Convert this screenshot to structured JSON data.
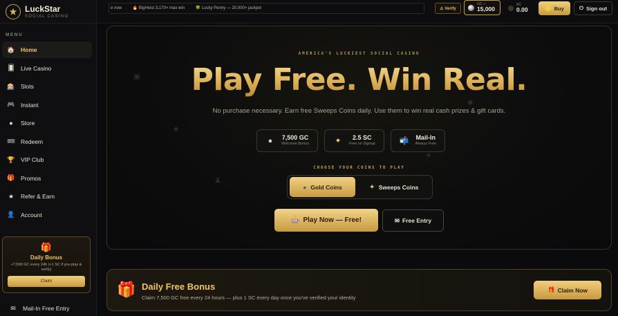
{
  "brand": {
    "name": "LuckStar",
    "tagline": "SOCIAL CASINO",
    "logo_icon": "star-coin-logo"
  },
  "sidebar": {
    "menu_title": "MENU",
    "items": [
      {
        "label": "Home",
        "icon": "🏠",
        "active": true
      },
      {
        "label": "Live Casino",
        "icon": "🂠"
      },
      {
        "label": "Slots",
        "icon": "🎰"
      },
      {
        "label": "Instant",
        "icon": "🎮"
      },
      {
        "label": "Store",
        "icon": "●"
      },
      {
        "label": "Redeem",
        "icon": "🎟"
      },
      {
        "label": "VIP Club",
        "icon": "🏆"
      },
      {
        "label": "Promos",
        "icon": "🎁"
      },
      {
        "label": "Refer & Earn",
        "icon": "★"
      },
      {
        "label": "Account",
        "icon": "👤"
      }
    ],
    "bonus_card": {
      "icon": "🎁",
      "title": "Daily Bonus",
      "desc": "+7,500 GC every 24h (+1 SC if you play & verify)",
      "claim_label": "Claim"
    },
    "mailin": {
      "label": "Mail-In Free Entry",
      "icon": "✉"
    }
  },
  "topbar": {
    "ticker": [
      "e now",
      "🔥 BigHeist 3,170× max win",
      "🍀 Lucky Penny — 20,000× jackpot"
    ],
    "ticker_sep": "·",
    "verify_label": "⚠ Verify",
    "gc_label": "GC ✓",
    "gc_value": "15,000",
    "sc_label": "SC",
    "sc_value": "0.00",
    "buy_label": "Buy",
    "buy_icon": "🪙",
    "signout_label": "Sign out",
    "signout_icon": "⏻"
  },
  "hero": {
    "eyebrow": "AMERICA'S LUCKIEST SOCIAL CASINO",
    "title": "Play Free. Win Real.",
    "subtitle": "No purchase necessary. Earn free Sweeps Coins daily. Use them to win real cash prizes & gift cards.",
    "stats": [
      {
        "value": "7,500 GC",
        "label": "Welcome Bonus",
        "icon": "●"
      },
      {
        "value": "2.5 SC",
        "label": "Free on Signup",
        "icon": "✦"
      },
      {
        "value": "Mail-In",
        "label": "Always Free",
        "icon": "📬"
      }
    ],
    "choose_label": "CHOOSE YOUR COINS TO PLAY",
    "coin_options": [
      {
        "label": "Gold Coins",
        "icon": "●",
        "active": true
      },
      {
        "label": "Sweeps Coins",
        "icon": "✦",
        "active": false
      }
    ],
    "play_label": "Play Now — Free!",
    "play_icon": "🎰",
    "free_entry_label": "Free Entry",
    "free_entry_icon": "✉"
  },
  "daily": {
    "icon": "🎁",
    "title": "Daily Free Bonus",
    "desc": "Claim 7,500 GC free every 24 hours — plus 1 SC every day once you've verified your identity",
    "claim_label": "Claim Now",
    "claim_icon": "🎁"
  },
  "colors": {
    "gold": "#e6c170",
    "accent_dark": "#2b1d07",
    "background": "#0b0b0d"
  }
}
